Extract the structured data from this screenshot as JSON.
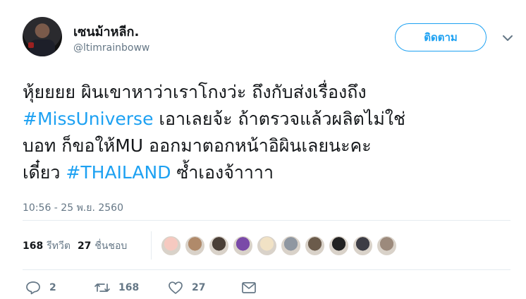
{
  "user": {
    "name": "เซนม้าหลีก.",
    "handle": "@ltimrainboww"
  },
  "follow_label": "ติดตาม",
  "tweet": {
    "line1": "หุ้ยยยย ผินเขาหาว่าเราโกงว่ะ ถึงกับส่งเรื่องถึง",
    "line2_tag": "#MissUniverse",
    "line2_rest": " เอาเลยจ้ะ ถ้าตรวจแล้วผลิตไม่ใช่",
    "line3": "บอท ก็ขอให้MU ออกมาตอกหน้าอิผินเลยนะคะ",
    "line4_start": "เดี๋ยว ",
    "line4_tag": "#THAILAND",
    "line4_rest": " ซ้ำเองจ้าาาา"
  },
  "timestamp": "10:56 - 25 พ.ย. 2560",
  "stats": {
    "retweets_count": "168",
    "retweets_label": "รีทวีต",
    "likes_count": "27",
    "likes_label": "ชื่นชอบ"
  },
  "likers": [
    {
      "color": "#f6c9c0"
    },
    {
      "color": "#b08a6a"
    },
    {
      "color": "#4a3f37"
    },
    {
      "color": "#7a4aa8"
    },
    {
      "color": "#f1e2c5"
    },
    {
      "color": "#8f97a1"
    },
    {
      "color": "#6b5b4b"
    },
    {
      "color": "#222222"
    },
    {
      "color": "#3d3d45"
    },
    {
      "color": "#9c8a7c"
    }
  ],
  "actions": {
    "reply_count": "2",
    "retweet_count": "168",
    "like_count": "27"
  },
  "icons": [
    "reply-icon",
    "retweet-icon",
    "like-icon",
    "message-icon",
    "chevron-down-icon"
  ],
  "colors": {
    "accent": "#1da1f2",
    "muted": "#657786",
    "text": "#14171a"
  }
}
